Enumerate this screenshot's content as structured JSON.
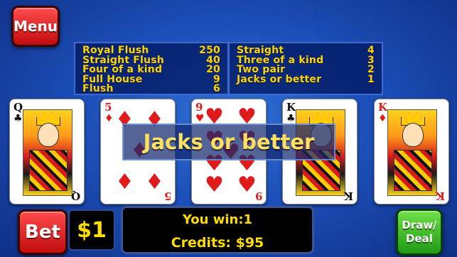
{
  "menu": {
    "label": "Menu"
  },
  "paytable": {
    "left": [
      {
        "hand": "Royal Flush",
        "pay": "250"
      },
      {
        "hand": "Straight Flush",
        "pay": "40"
      },
      {
        "hand": "Four of a kind",
        "pay": "20"
      },
      {
        "hand": "Full House",
        "pay": "9"
      },
      {
        "hand": "Flush",
        "pay": "6"
      }
    ],
    "right": [
      {
        "hand": "Straight",
        "pay": "4"
      },
      {
        "hand": "Three of a kind",
        "pay": "3"
      },
      {
        "hand": "Two pair",
        "pay": "2"
      },
      {
        "hand": "Jacks or better",
        "pay": "1"
      }
    ]
  },
  "cards": [
    {
      "rank": "Q",
      "suit": "♣",
      "color": "black",
      "face": true
    },
    {
      "rank": "5",
      "suit": "♦",
      "color": "red",
      "face": false
    },
    {
      "rank": "9",
      "suit": "♥",
      "color": "red",
      "face": false
    },
    {
      "rank": "K",
      "suit": "♣",
      "color": "black",
      "face": true
    },
    {
      "rank": "K",
      "suit": "♦",
      "color": "red",
      "face": true
    }
  ],
  "result_banner": "Jacks or better",
  "bet": {
    "label": "Bet",
    "amount": "$1"
  },
  "status": {
    "win": "You win:1",
    "credits": "Credits: $95"
  },
  "draw_deal": {
    "line1": "Draw/",
    "line2": "Deal"
  },
  "colors": {
    "gold": "#ffdd00",
    "red_button": "#d81b1b",
    "green_button": "#1f9b12",
    "table_blue": "#1c4fb8"
  }
}
